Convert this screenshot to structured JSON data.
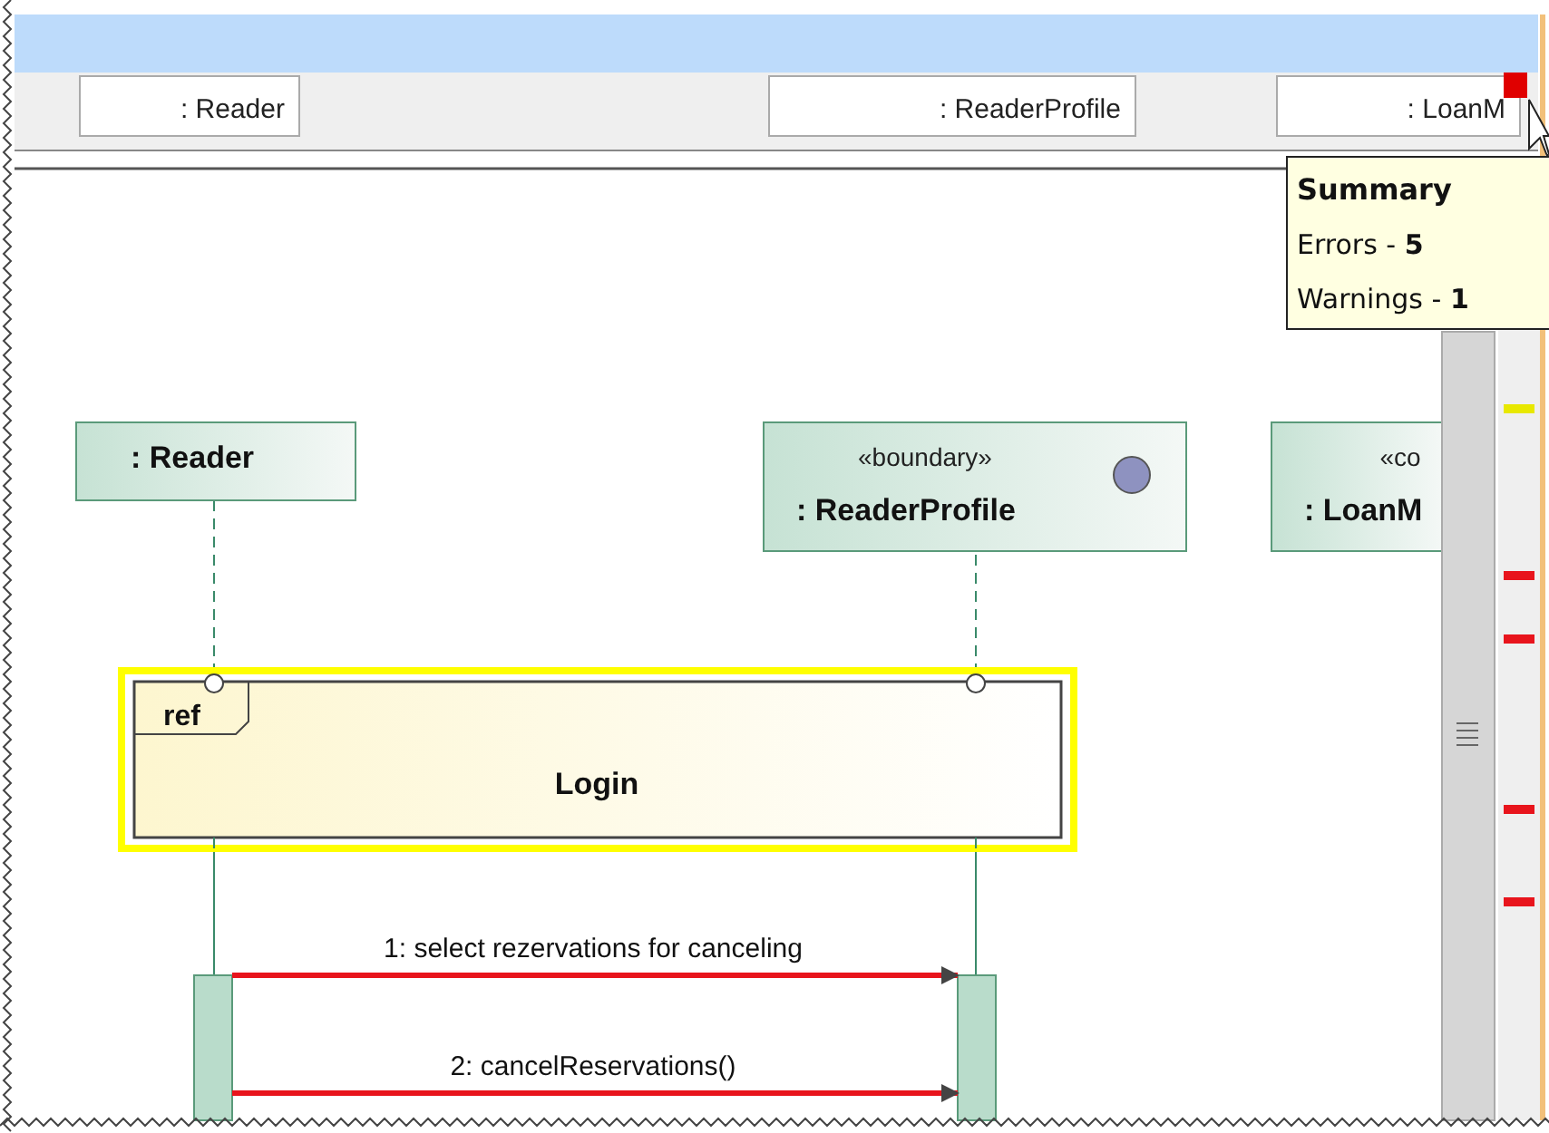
{
  "header_boxes": [
    {
      "label": ": Reader"
    },
    {
      "label": ": ReaderProfile"
    },
    {
      "label": ": LoanM"
    }
  ],
  "lifelines": [
    {
      "kind": "plain",
      "name": ": Reader"
    },
    {
      "kind": "boundary",
      "stereotype": "«boundary»",
      "name": ": ReaderProfile"
    },
    {
      "kind": "control",
      "stereotype": "«co",
      "name": ": LoanM"
    }
  ],
  "ref_frame": {
    "tag": "ref",
    "name": "Login",
    "selected": true
  },
  "messages": [
    {
      "label": "1: select rezervations for canceling"
    },
    {
      "label": "2: cancelReservations()"
    }
  ],
  "tooltip": {
    "title": "Summary",
    "lines": [
      "Errors - **5**",
      "Warnings - **1**"
    ]
  },
  "error_stripe": [
    {
      "color": "#e8e800"
    },
    {
      "color": "#e8141c"
    },
    {
      "color": "#e8141c"
    },
    {
      "color": "#e8141c"
    },
    {
      "color": "#e8141c"
    }
  ]
}
